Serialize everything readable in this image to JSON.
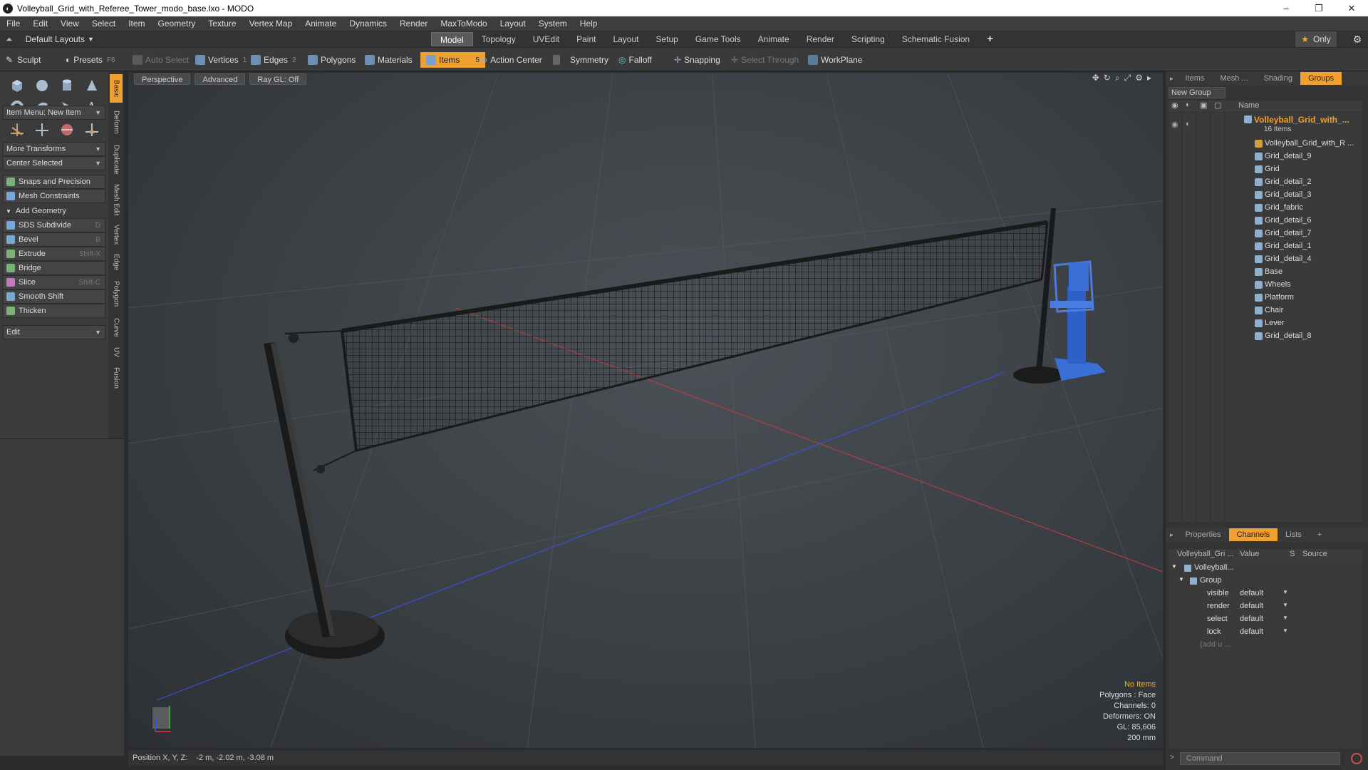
{
  "window": {
    "title": "Volleyball_Grid_with_Referee_Tower_modo_base.lxo - MODO",
    "minimize": "–",
    "maximize": "❐",
    "close": "✕"
  },
  "menu": [
    "File",
    "Edit",
    "View",
    "Select",
    "Item",
    "Geometry",
    "Texture",
    "Vertex Map",
    "Animate",
    "Dynamics",
    "Render",
    "MaxToModo",
    "Layout",
    "System",
    "Help"
  ],
  "layout_selector": "Default Layouts",
  "tabs": [
    "Model",
    "Topology",
    "UVEdit",
    "Paint",
    "Layout",
    "Setup",
    "Game Tools",
    "Animate",
    "Render",
    "Scripting",
    "Schematic Fusion"
  ],
  "active_tab": "Model",
  "only_label": "Only",
  "toolbar": {
    "sculpt": "Sculpt",
    "presets": "Presets",
    "presets_key": "F6",
    "auto_select": "Auto Select",
    "vertices": "Vertices",
    "vertices_num": "1",
    "edges": "Edges",
    "edges_num": "2",
    "polygons": "Polygons",
    "materials": "Materials",
    "items": "Items",
    "items_num": "5",
    "action_center": "Action Center",
    "symmetry": "Symmetry",
    "falloff": "Falloff",
    "snapping": "Snapping",
    "select_through": "Select Through",
    "workplane": "WorkPlane"
  },
  "left": {
    "item_menu": "Item Menu: New Item",
    "more_transforms": "More Transforms",
    "center_selected": "Center Selected",
    "snaps": "Snaps and Precision",
    "mesh_constraints": "Mesh Constraints",
    "add_geometry": "Add Geometry",
    "tools": [
      {
        "label": "SDS Subdivide",
        "key": "D"
      },
      {
        "label": "Bevel",
        "key": "B"
      },
      {
        "label": "Extrude",
        "key": "Shift-X"
      },
      {
        "label": "Bridge",
        "key": ""
      },
      {
        "label": "Slice",
        "key": "Shift-C"
      },
      {
        "label": "Smooth Shift",
        "key": ""
      },
      {
        "label": "Thicken",
        "key": ""
      }
    ],
    "edit": "Edit",
    "side_tabs": [
      "Basic",
      "Deform",
      "Duplicate",
      "Mesh Edit",
      "Vertex",
      "Edge",
      "Polygon",
      "Curve",
      "UV",
      "Fusion"
    ]
  },
  "viewport": {
    "perspective": "Perspective",
    "advanced": "Advanced",
    "raygl": "Ray GL: Off",
    "info": [
      "No Items",
      "Polygons : Face",
      "Channels: 0",
      "Deformers: ON",
      "GL: 85,606",
      "200 mm"
    ]
  },
  "status": {
    "label": "Position X, Y, Z:",
    "value": "-2 m, -2.02 m, -3.08 m"
  },
  "right": {
    "tabs": [
      "Items",
      "Mesh ...",
      "Shading",
      "Groups"
    ],
    "active_tab": "Groups",
    "new_group": "New Group",
    "name_col": "Name",
    "root": {
      "label": "Volleyball_Grid_with_...",
      "count": "16 Items"
    },
    "items": [
      "Volleyball_Grid_with_R ...",
      "Grid_detail_9",
      "Grid",
      "Grid_detail_2",
      "Grid_detail_3",
      "Grid_fabric",
      "Grid_detail_6",
      "Grid_detail_7",
      "Grid_detail_1",
      "Grid_detail_4",
      "Base",
      "Wheels",
      "Platform",
      "Chair",
      "Lever",
      "Grid_detail_8"
    ],
    "bottom_tabs": [
      "Properties",
      "Channels",
      "Lists",
      "+"
    ],
    "bottom_active": "Channels",
    "channel_cols": {
      "name": "Volleyball_Gri ...",
      "value": "Value",
      "s": "S",
      "source": "Source"
    },
    "channel_root": "Volleyball...",
    "channel_group": "Group",
    "channels": [
      {
        "name": "visible",
        "value": "default"
      },
      {
        "name": "render",
        "value": "default"
      },
      {
        "name": "select",
        "value": "default"
      },
      {
        "name": "lock",
        "value": "default"
      }
    ],
    "add_user": "(add u ..."
  },
  "command_placeholder": "Command",
  "colors": {
    "accent": "#f0a030",
    "tower_blue": "#3a6fd8",
    "axis_red": "#c0392b",
    "axis_blue": "#3a4fd8"
  }
}
